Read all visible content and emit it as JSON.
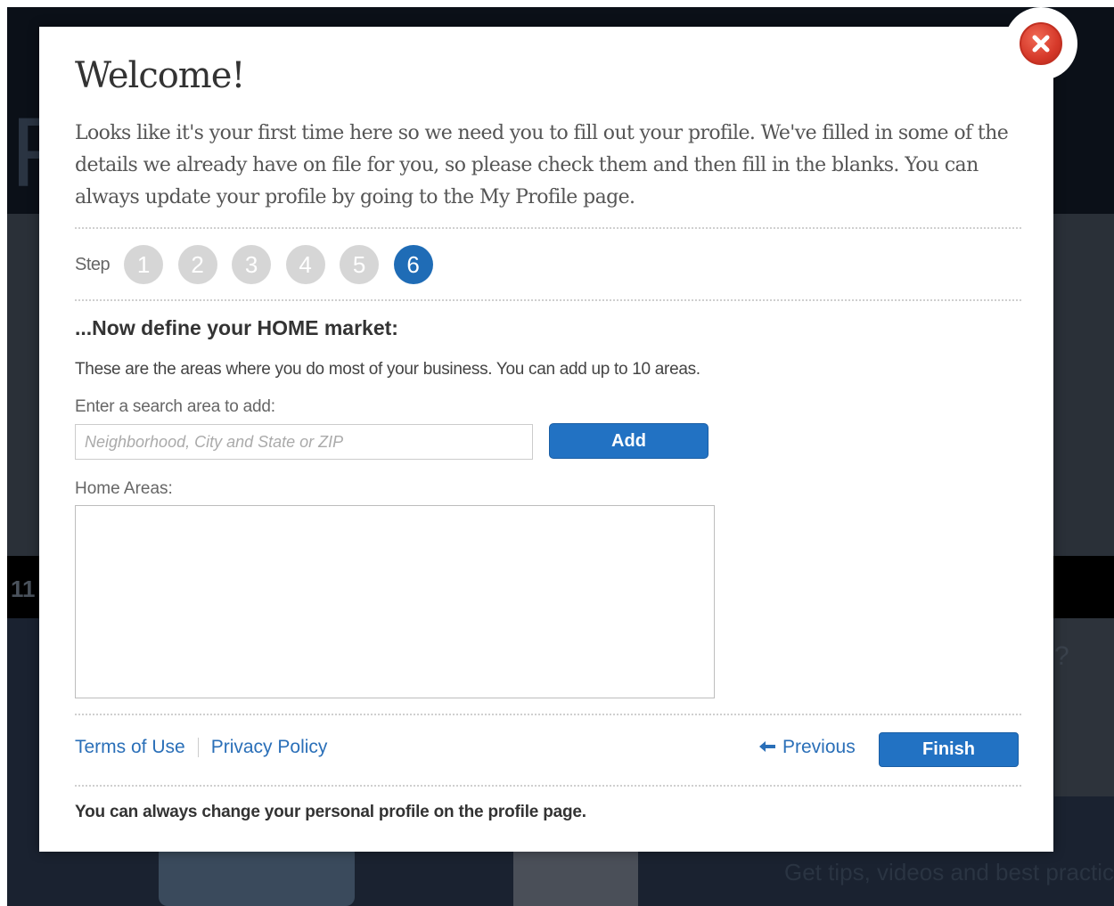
{
  "background": {
    "letter": "F",
    "number": "11",
    "question": "?",
    "tips_text": "Get tips, videos and best practice"
  },
  "modal": {
    "title": "Welcome!",
    "intro": "Looks like it's your first time here so we need you to fill out your profile. We've filled in some of the details we already have on file for you, so please check them and then fill in the blanks. You can always update your profile by going to the My Profile page.",
    "close_icon": "close-x-icon",
    "steps": {
      "label": "Step",
      "items": [
        {
          "label": "1",
          "state": "done"
        },
        {
          "label": "2",
          "state": "done"
        },
        {
          "label": "3",
          "state": "done"
        },
        {
          "label": "4",
          "state": "done"
        },
        {
          "label": "5",
          "state": "done"
        },
        {
          "label": "6",
          "state": "active"
        }
      ],
      "current": 6
    },
    "section_heading": "...Now define your HOME market:",
    "description": "These are the areas where you do most of your business. You can add up to 10 areas.",
    "search": {
      "label": "Enter a search area to add:",
      "placeholder": "Neighborhood, City and State or ZIP",
      "value": "",
      "add_label": "Add"
    },
    "home_areas": {
      "label": "Home Areas:",
      "items": []
    },
    "footer": {
      "terms_label": "Terms of Use",
      "privacy_label": "Privacy Policy",
      "previous_label": "Previous",
      "previous_icon": "arrow-left-icon",
      "finish_label": "Finish"
    },
    "bottom_note": "You can always change your personal profile on the profile page."
  },
  "colors": {
    "accent": "#2272c3",
    "step_active": "#1f6cb6",
    "step_done": "#d6d6d6",
    "link": "#2a6fb8",
    "close": "#d6392a"
  }
}
